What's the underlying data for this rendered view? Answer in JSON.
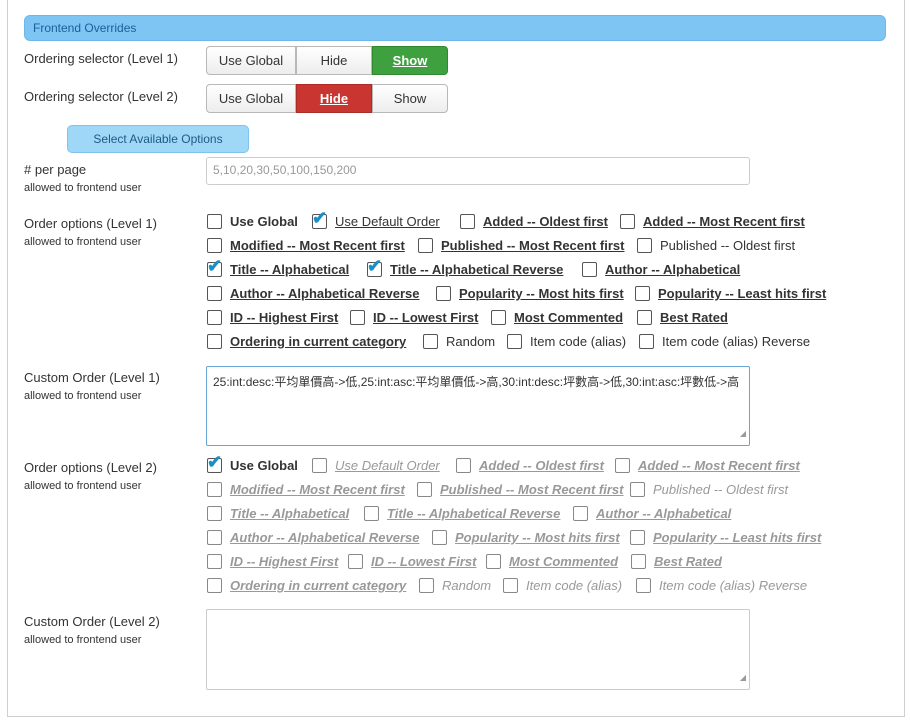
{
  "panel": {
    "title": "Frontend Overrides"
  },
  "ordering1": {
    "label": "Ordering selector (Level 1)",
    "buttons": [
      "Use Global",
      "Hide",
      "Show"
    ]
  },
  "ordering2": {
    "label": "Ordering selector (Level 2)",
    "buttons": [
      "Use Global",
      "Hide",
      "Show"
    ]
  },
  "select_options_label": "Select Available Options",
  "per_page": {
    "label": "# per page",
    "sub": "allowed to frontend user",
    "value": "5,10,20,30,50,100,150,200"
  },
  "order_options_1": {
    "label": "Order options (Level 1)",
    "sub": "allowed to frontend user",
    "items": [
      {
        "label": "Use Global",
        "checked": false
      },
      {
        "label": "Use Default Order",
        "checked": true
      },
      {
        "label": "Added -- Oldest first",
        "checked": false
      },
      {
        "label": "Added -- Most Recent first",
        "checked": false
      },
      {
        "label": "Modified -- Most Recent first",
        "checked": false
      },
      {
        "label": "Published -- Most Recent first",
        "checked": false
      },
      {
        "label": "Published -- Oldest first",
        "checked": false
      },
      {
        "label": "Title -- Alphabetical",
        "checked": true
      },
      {
        "label": "Title -- Alphabetical Reverse",
        "checked": true
      },
      {
        "label": "Author -- Alphabetical",
        "checked": false
      },
      {
        "label": "Author -- Alphabetical Reverse",
        "checked": false
      },
      {
        "label": "Popularity -- Most hits first",
        "checked": false
      },
      {
        "label": "Popularity -- Least hits first",
        "checked": false
      },
      {
        "label": "ID -- Highest First",
        "checked": false
      },
      {
        "label": "ID -- Lowest First",
        "checked": false
      },
      {
        "label": "Most Commented",
        "checked": false
      },
      {
        "label": "Best Rated",
        "checked": false
      },
      {
        "label": "Ordering in current category",
        "checked": false
      },
      {
        "label": "Random",
        "checked": false
      },
      {
        "label": "Item code (alias)",
        "checked": false
      },
      {
        "label": "Item code (alias) Reverse",
        "checked": false
      }
    ]
  },
  "custom_order_1": {
    "label": "Custom Order (Level 1)",
    "sub": "allowed to frontend user",
    "value": "25:int:desc:平均單價高->低,25:int:asc:平均單價低->高,30:int:desc:坪數高->低,30:int:asc:坪數低->高"
  },
  "order_options_2": {
    "label": "Order options (Level 2)",
    "sub": "allowed to frontend user",
    "items": [
      {
        "label": "Use Global",
        "checked": true
      },
      {
        "label": "Use Default Order",
        "checked": false
      },
      {
        "label": "Added -- Oldest first",
        "checked": false
      },
      {
        "label": "Added -- Most Recent first",
        "checked": false
      },
      {
        "label": "Modified -- Most Recent first",
        "checked": false
      },
      {
        "label": "Published -- Most Recent first",
        "checked": false
      },
      {
        "label": "Published -- Oldest first",
        "checked": false
      },
      {
        "label": "Title -- Alphabetical",
        "checked": false
      },
      {
        "label": "Title -- Alphabetical Reverse",
        "checked": false
      },
      {
        "label": "Author -- Alphabetical",
        "checked": false
      },
      {
        "label": "Author -- Alphabetical Reverse",
        "checked": false
      },
      {
        "label": "Popularity -- Most hits first",
        "checked": false
      },
      {
        "label": "Popularity -- Least hits first",
        "checked": false
      },
      {
        "label": "ID -- Highest First",
        "checked": false
      },
      {
        "label": "ID -- Lowest First",
        "checked": false
      },
      {
        "label": "Most Commented",
        "checked": false
      },
      {
        "label": "Best Rated",
        "checked": false
      },
      {
        "label": "Ordering in current category",
        "checked": false
      },
      {
        "label": "Random",
        "checked": false
      },
      {
        "label": "Item code (alias)",
        "checked": false
      },
      {
        "label": "Item code (alias) Reverse",
        "checked": false
      }
    ]
  },
  "custom_order_2": {
    "label": "Custom Order (Level 2)",
    "sub": "allowed to frontend user",
    "value": ""
  },
  "colors": {
    "header_bg": "#7fc5f4",
    "show_active": "#3ea03e",
    "hide_active": "#c93632",
    "check_tick": "#1a8ec9"
  },
  "icons": {
    "check": "checkmark-icon",
    "resize": "resize-grip-icon"
  }
}
